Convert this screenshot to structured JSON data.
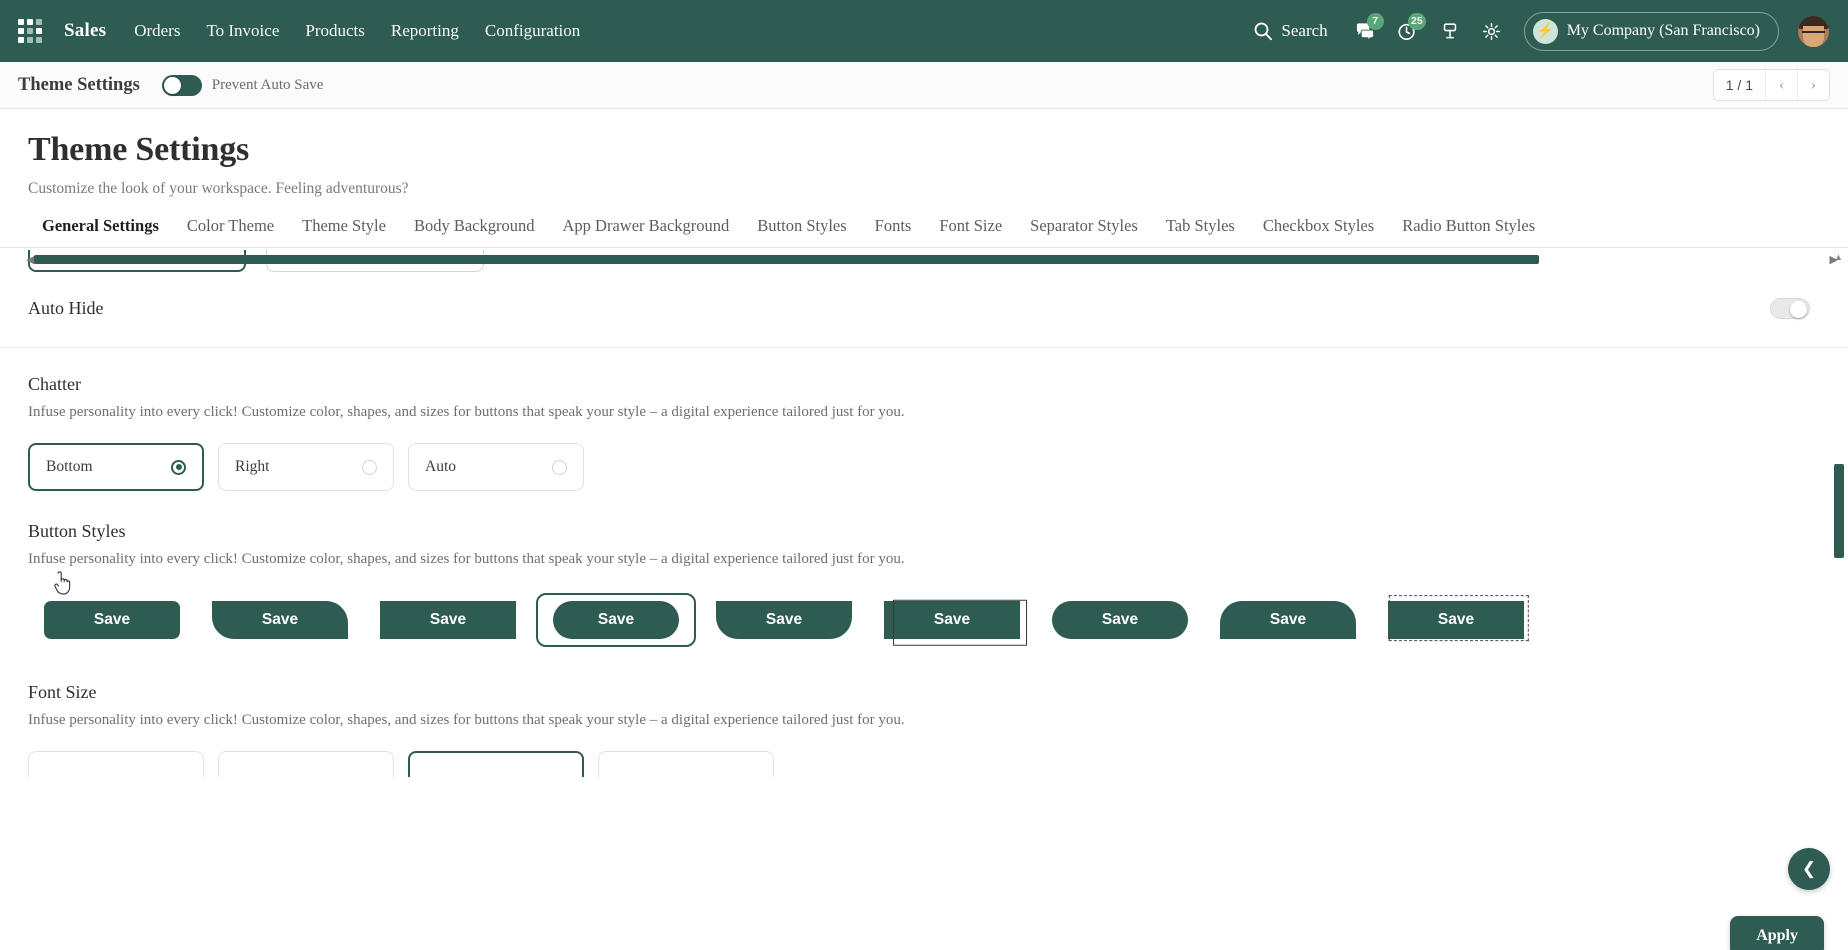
{
  "navbar": {
    "apps_icon": "apps-grid-icon",
    "brand": "Sales",
    "menu": [
      {
        "label": "Orders"
      },
      {
        "label": "To Invoice"
      },
      {
        "label": "Products"
      },
      {
        "label": "Reporting"
      },
      {
        "label": "Configuration"
      }
    ],
    "search_label": "Search",
    "search_icon": "search-icon",
    "messages_icon": "chat-bubble-icon",
    "messages_badge": "7",
    "activities_icon": "clock-icon",
    "activities_badge": "25",
    "debug_icon": "bug-icon",
    "settings_icon": "gear-icon",
    "company": "My Company (San Francisco)",
    "company_icon": "bolt-icon",
    "avatar": "user-avatar"
  },
  "breadcrumb": {
    "title": "Theme Settings",
    "prevent_auto_save_label": "Prevent Auto Save",
    "prevent_auto_save_on": true,
    "pager_count": "1 / 1",
    "prev_icon": "chevron-left-icon",
    "next_icon": "chevron-right-icon"
  },
  "page": {
    "title": "Theme Settings",
    "subtitle": "Customize the look of your workspace. Feeling adventurous?"
  },
  "tabs": [
    {
      "label": "General Settings",
      "active": true
    },
    {
      "label": "Color Theme",
      "active": false
    },
    {
      "label": "Theme Style",
      "active": false
    },
    {
      "label": "Body Background",
      "active": false
    },
    {
      "label": "App Drawer Background",
      "active": false
    },
    {
      "label": "Button Styles",
      "active": false
    },
    {
      "label": "Fonts",
      "active": false
    },
    {
      "label": "Font Size",
      "active": false
    },
    {
      "label": "Separator Styles",
      "active": false
    },
    {
      "label": "Tab Styles",
      "active": false
    },
    {
      "label": "Checkbox Styles",
      "active": false
    },
    {
      "label": "Radio Button Styles",
      "active": false
    }
  ],
  "auto_hide": {
    "label": "Auto Hide",
    "enabled": false
  },
  "chatter": {
    "heading": "Chatter",
    "description": "Infuse personality into every click! Customize color, shapes, and sizes for buttons that speak your style – a digital experience tailored just for you.",
    "options": [
      {
        "label": "Bottom",
        "selected": true
      },
      {
        "label": "Right",
        "selected": false
      },
      {
        "label": "Auto",
        "selected": false
      }
    ]
  },
  "button_styles": {
    "heading": "Button Styles",
    "description": "Infuse personality into every click! Customize color, shapes, and sizes for buttons that speak your style – a digital experience tailored just for you.",
    "samples": [
      {
        "label": "Save",
        "shape": "rounded",
        "selected": false
      },
      {
        "label": "Save",
        "shape": "diagonal",
        "selected": false
      },
      {
        "label": "Save",
        "shape": "square",
        "selected": false
      },
      {
        "label": "Save",
        "shape": "pill",
        "selected": true
      },
      {
        "label": "Save",
        "shape": "bottom-round",
        "selected": false
      },
      {
        "label": "Save",
        "shape": "offset-frame",
        "selected": false
      },
      {
        "label": "Save",
        "shape": "pill-wide",
        "selected": false
      },
      {
        "label": "Save",
        "shape": "top-round",
        "selected": false
      },
      {
        "label": "Save",
        "shape": "dashed-frame",
        "selected": false
      }
    ]
  },
  "font_size": {
    "heading": "Font Size",
    "description": "Infuse personality into every click! Customize color, shapes, and sizes for buttons that speak your style – a digital experience tailored just for you."
  },
  "floating": {
    "collapse_icon": "chevron-left-icon",
    "apply_label": "Apply"
  },
  "colors": {
    "brand": "#2e5b52",
    "badge": "#5ba678",
    "accent_text": "#ffffff"
  }
}
